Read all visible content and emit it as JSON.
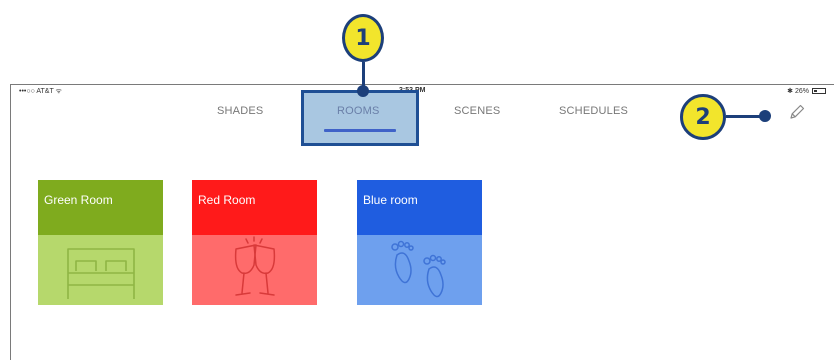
{
  "status_bar": {
    "carrier": "•••○○ AT&T ᯤ",
    "time": "3:53 PM",
    "battery": "✱ 26%"
  },
  "tabs": [
    {
      "label": "SHADES"
    },
    {
      "label": "ROOMS",
      "selected": true
    },
    {
      "label": "SCENES"
    },
    {
      "label": "SCHEDULES"
    }
  ],
  "rooms": [
    {
      "label": "Green Room",
      "icon": "bed-icon",
      "top_color": "#7fab1e",
      "bottom_color": "#b6d86c"
    },
    {
      "label": "Red Room",
      "icon": "champagne-glasses-icon",
      "top_color": "#ff1a1a",
      "bottom_color": "#ff6b6b"
    },
    {
      "label": "Blue room",
      "icon": "footprints-icon",
      "top_color": "#1f5de0",
      "bottom_color": "#6ea0ee"
    }
  ],
  "edit_icon": "pencil-icon",
  "callouts": [
    {
      "number": "1",
      "target": "ROOMS tab"
    },
    {
      "number": "2",
      "target": "edit pencil"
    }
  ],
  "colors": {
    "callout_fill": "#f2e52c",
    "callout_border": "#1c3f7a",
    "tab_selected_underline": "#3f62c8"
  }
}
